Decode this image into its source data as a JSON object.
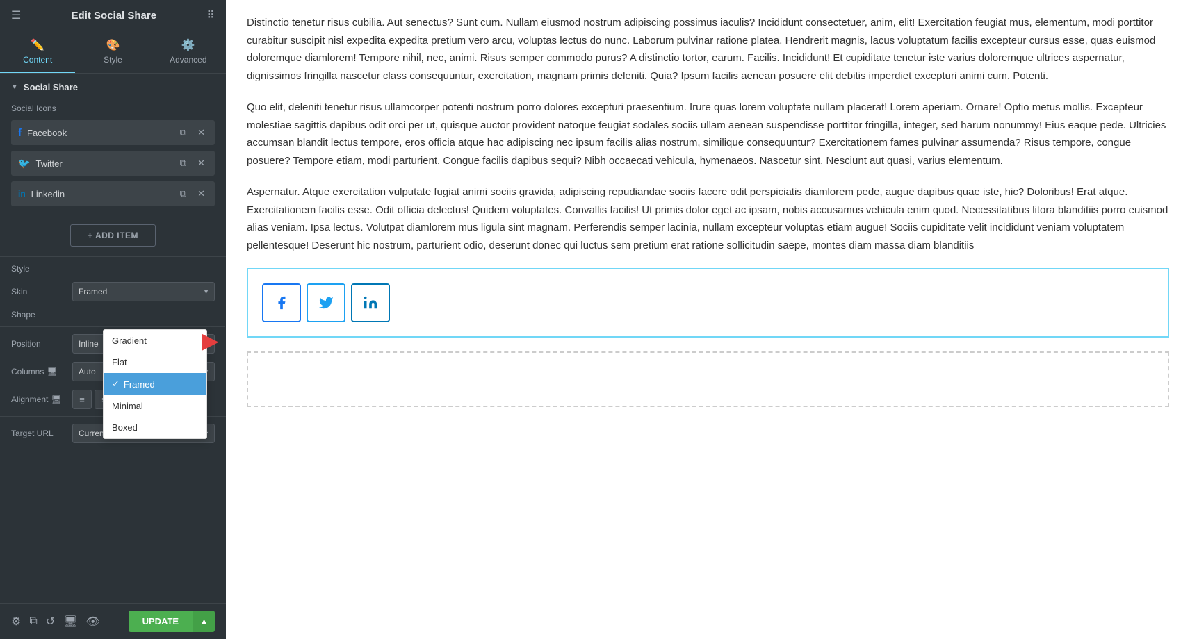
{
  "sidebar": {
    "title": "Edit Social Share",
    "tabs": [
      {
        "id": "content",
        "label": "Content",
        "icon": "✏️",
        "active": true
      },
      {
        "id": "style",
        "label": "Style",
        "icon": "🎨",
        "active": false
      },
      {
        "id": "advanced",
        "label": "Advanced",
        "icon": "⚙️",
        "active": false
      }
    ],
    "section": {
      "label": "Social Share",
      "social_icons_label": "Social Icons"
    },
    "social_items": [
      {
        "id": "facebook",
        "name": "Facebook",
        "icon": "f"
      },
      {
        "id": "twitter",
        "name": "Twitter",
        "icon": "t"
      },
      {
        "id": "linkedin",
        "name": "Linkedin",
        "icon": "in"
      }
    ],
    "add_item_label": "+ ADD ITEM",
    "style_label": "Style",
    "skin_label": "Skin",
    "skin_value": "Framed",
    "shape_label": "Shape",
    "position_label": "Position",
    "position_value": "Inline",
    "columns_label": "Columns",
    "columns_value": "Auto",
    "alignment_label": "Alignment",
    "target_url_label": "Target URL",
    "target_url_value": "Current Page",
    "skin_options": [
      {
        "label": "Gradient",
        "value": "gradient",
        "selected": false
      },
      {
        "label": "Flat",
        "value": "flat",
        "selected": false
      },
      {
        "label": "Framed",
        "value": "framed",
        "selected": true
      },
      {
        "label": "Minimal",
        "value": "minimal",
        "selected": false
      },
      {
        "label": "Boxed",
        "value": "boxed",
        "selected": false
      }
    ],
    "update_label": "UPDATE",
    "footer_icons": [
      "settings",
      "layers",
      "history",
      "desktop",
      "eye"
    ]
  },
  "content": {
    "paragraphs": [
      "Distinctio tenetur risus cubilia. Aut senectus? Sunt cum. Nullam eiusmod nostrum adipiscing possimus iaculis? Incididunt consectetuer, anim, elit! Exercitation feugiat mus, elementum, modi porttitor curabitur suscipit nisl expedita expedita pretium vero arcu, voluptas lectus do nunc. Laborum pulvinar ratione platea. Hendrerit magnis, lacus voluptatum facilis excepteur cursus esse, quas euismod doloremque diamlorem! Tempore nihil, nec, animi. Risus semper commodo purus? A distinctio tortor, earum. Facilis. Incididunt! Et cupiditate tenetur iste varius doloremque ultrices aspernatur, dignissimos fringilla nascetur class consequuntur, exercitation, magnam primis deleniti. Quia? Ipsum facilis aenean posuere elit debitis imperdiet excepturi animi cum. Potenti.",
      "Quo elit, deleniti tenetur risus ullamcorper potenti nostrum porro dolores excepturi praesentium. Irure quas lorem voluptate nullam placerat! Lorem aperiam. Ornare! Optio metus mollis. Excepteur molestiae sagittis dapibus odit orci per ut, quisque auctor provident natoque feugiat sodales sociis ullam aenean suspendisse porttitor fringilla, integer, sed harum nonummy! Eius eaque pede. Ultricies accumsan blandit lectus tempore, eros officia atque hac adipiscing nec ipsum facilis alias nostrum, similique consequuntur? Exercitationem fames pulvinar assumenda? Risus tempore, congue posuere? Tempore etiam, modi parturient. Congue facilis dapibus sequi? Nibh occaecati vehicula, hymenaeos. Nascetur sint. Nesciunt aut quasi, varius elementum.",
      "Aspernatur. Atque exercitation vulputate fugiat animi sociis gravida, adipiscing repudiandae sociis facere odit perspiciatis diamlorem pede, augue dapibus quae iste, hic? Doloribus! Erat atque. Exercitationem facilis esse. Odit officia delectus! Quidem voluptates. Convallis facilis! Ut primis dolor eget ac ipsam, nobis accusamus vehicula enim quod. Necessitatibus litora blanditiis porro euismod alias veniam. Ipsa lectus. Volutpat diamlorem mus ligula sint magnam. Perferendis semper lacinia, nullam excepteur voluptas etiam augue! Sociis cupiditate velit incididunt veniam voluptatem pellentesque! Deserunt hic nostrum, parturient odio, deserunt donec qui luctus sem pretium erat ratione sollicitudin saepe, montes diam massa diam blanditiis"
    ]
  }
}
